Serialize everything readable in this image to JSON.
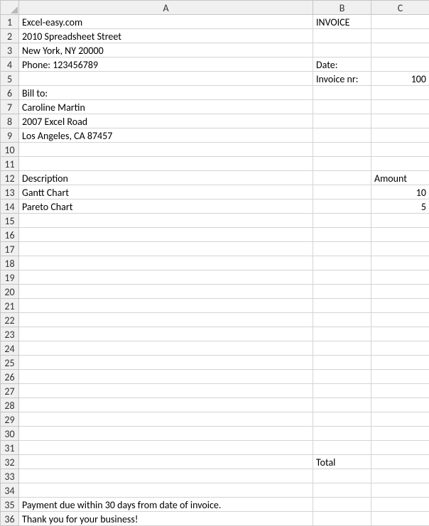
{
  "columns": [
    "A",
    "B",
    "C"
  ],
  "rowCount": 36,
  "cells": {
    "A1": "Excel-easy.com",
    "B1": "INVOICE",
    "A2": "2010 Spreadsheet Street",
    "A3": "New York, NY 20000",
    "A4": "Phone: 123456789",
    "B4": "Date:",
    "B5": "Invoice nr:",
    "C5": "100",
    "A6": "Bill to:",
    "A7": "Caroline Martin",
    "A8": "2007 Excel Road",
    "A9": "Los Angeles, CA 87457",
    "A12": "Description",
    "C12": "Amount",
    "A13": "Gantt Chart",
    "C13": "10",
    "A14": "Pareto Chart",
    "C14": "5",
    "B32": "Total",
    "A35": "Payment due within 30 days from date of invoice.",
    "A36": "Thank you for your business!"
  },
  "numericCells": [
    "C5",
    "C13",
    "C14"
  ]
}
